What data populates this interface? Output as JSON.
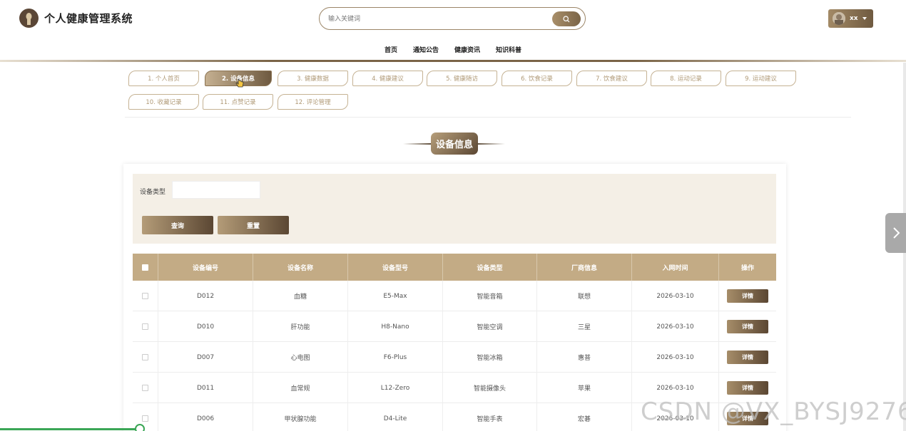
{
  "app": {
    "title": "个人健康管理系统"
  },
  "search": {
    "placeholder": "输入关键词"
  },
  "user": {
    "name": "xx"
  },
  "nav": {
    "items": [
      "首页",
      "通知公告",
      "健康资讯",
      "知识科普"
    ]
  },
  "tabs": [
    "1. 个人首页",
    "2. 设备信息",
    "3. 健康数据",
    "4. 健康建议",
    "5. 健康随访",
    "6. 饮食记录",
    "7. 饮食建议",
    "8. 运动记录",
    "9. 运动建议",
    "10. 收藏记录",
    "11. 点赞记录",
    "12. 评论管理"
  ],
  "active_tab": "2. 设备信息",
  "section": {
    "title": "设备信息"
  },
  "filter": {
    "label": "设备类型",
    "value": "",
    "query_label": "查询",
    "reset_label": "重置"
  },
  "table": {
    "headers": [
      "设备编号",
      "设备名称",
      "设备型号",
      "设备类型",
      "厂商信息",
      "入网时间",
      "操作"
    ],
    "action_label": "详情",
    "rows": [
      [
        "D012",
        "血糖",
        "E5-Max",
        "智能音箱",
        "联想",
        "2026-03-10"
      ],
      [
        "D010",
        "肝功能",
        "H8-Nano",
        "智能空调",
        "三星",
        "2026-03-10"
      ],
      [
        "D007",
        "心电图",
        "F6-Plus",
        "智能冰箱",
        "惠普",
        "2026-03-10"
      ],
      [
        "D011",
        "血常规",
        "L12-Zero",
        "智能摄像头",
        "苹果",
        "2026-03-10"
      ],
      [
        "D006",
        "甲状腺功能",
        "D4-Lite",
        "智能手表",
        "宏碁",
        "2026-03-10"
      ]
    ]
  },
  "watermark": "CSDN @VX_BYSJ9276",
  "colors": {
    "brand_gold": "#c3ab85",
    "brand_dark": "#5b4733",
    "filter_bg": "#f4efe6"
  }
}
